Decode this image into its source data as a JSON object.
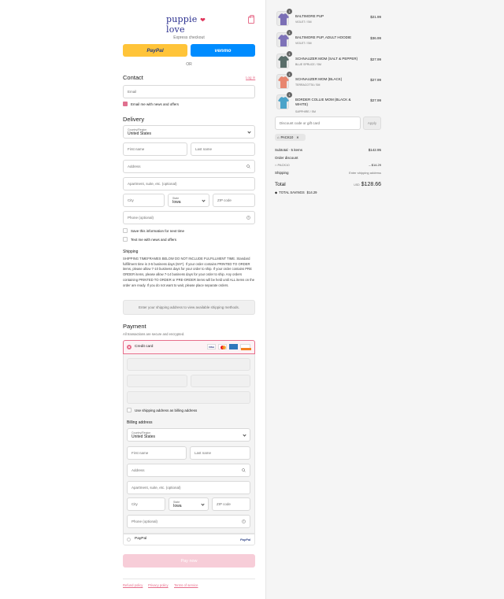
{
  "header": {
    "logo_text": "puppie",
    "logo_text2": "love",
    "express_checkout": "Express checkout",
    "paypal_label": "PayPal",
    "venmo_label": "venmo",
    "or_label": "OR"
  },
  "contact": {
    "heading": "Contact",
    "login_link": "Log in",
    "email_placeholder": "Email",
    "email_news_label": "Email me with news and offers",
    "email_news_checked": true
  },
  "delivery": {
    "heading": "Delivery",
    "country_label": "Country/Region",
    "country_value": "United States",
    "first_name_placeholder": "First name",
    "last_name_placeholder": "Last name",
    "address_placeholder": "Address",
    "apartment_placeholder": "Apartment, suite, etc. (optional)",
    "city_placeholder": "City",
    "state_label": "State",
    "state_value": "Iowa",
    "zip_placeholder": "ZIP code",
    "phone_placeholder": "Phone (optional)",
    "save_info_label": "Save this information for next time",
    "text_news_label": "Text me with news and offers"
  },
  "shipping": {
    "heading": "Shipping",
    "notice": "SHIPPING TIMEFRAMES BELOW DO NOT INCLUDE FULFILLMENT TIME. Standard fulfillment time is 3-5 business days (M-F). If your order contains PRINTED TO ORDER items, please allow 7-10 business days for your order to ship. If your order contains PRE ORDER items, please allow 7-14 business days for your order to ship. Any orders containing PRINTED TO ORDER or PRE-ORDER items will be held until ALL items on the order are ready. If you do not want to wait, please place separate orders.",
    "methods_placeholder": "Enter your shipping address to view available shipping methods."
  },
  "payment": {
    "heading": "Payment",
    "secure_note": "All transactions are secure and encrypted.",
    "credit_card_label": "Credit card",
    "card_brands": [
      "VISA",
      "MC",
      "AMEX",
      "DISCOVER"
    ],
    "use_shipping_label": "Use shipping address as billing address",
    "billing_heading": "Billing address",
    "paypal_option_label": "PayPal",
    "paypal_logo": "PayPal",
    "pay_now_label": "Pay now"
  },
  "footer": {
    "links": [
      "Refund policy",
      "Privacy policy",
      "Terms of service"
    ]
  },
  "cart": {
    "items": [
      {
        "qty": "1",
        "name": "BALTIMORE PUP",
        "variant": "VIOLET / SM",
        "price": "$21.99",
        "color": "#7b6fb5"
      },
      {
        "qty": "1",
        "name": "BALTIMORE PUP, ADULT HOODIE",
        "variant": "VIOLET / SM",
        "price": "$36.99",
        "color": "#7e72b8"
      },
      {
        "qty": "1",
        "name": "SCHNAUZER MOM (SALT & PEPPER)",
        "variant": "BLUE SPRUCE / SM",
        "price": "$27.99",
        "color": "#5a6e6a"
      },
      {
        "qty": "1",
        "name": "SCHNAUZER MOM (BLACK)",
        "variant": "TERRACOTTA / SM",
        "price": "$27.99",
        "color": "#e8866f"
      },
      {
        "qty": "1",
        "name": "BORDER COLLIE MOM (BLACK & WHITE)",
        "variant": "SAPPHIRE / SM",
        "price": "$27.99",
        "color": "#4aa3c9"
      }
    ],
    "discount_placeholder": "Discount code or gift card",
    "apply_label": "Apply",
    "applied_code": "PACK10",
    "subtotal_label": "Subtotal · 5 items",
    "subtotal_value": "$142.95",
    "order_discount_label": "Order discount",
    "discount_code_line": "PACK10",
    "discount_value": "– $14.29",
    "shipping_label": "Shipping",
    "shipping_value": "Enter shipping address",
    "total_label": "Total",
    "currency": "USD",
    "total_value": "$128.66",
    "savings_label": "TOTAL SAVINGS",
    "savings_value": "$14.29"
  },
  "colors": {
    "accent": "#e76f8c",
    "paypal_yellow": "#ffc439",
    "venmo_blue": "#008cff",
    "pay_button": "#f7cdd8"
  }
}
